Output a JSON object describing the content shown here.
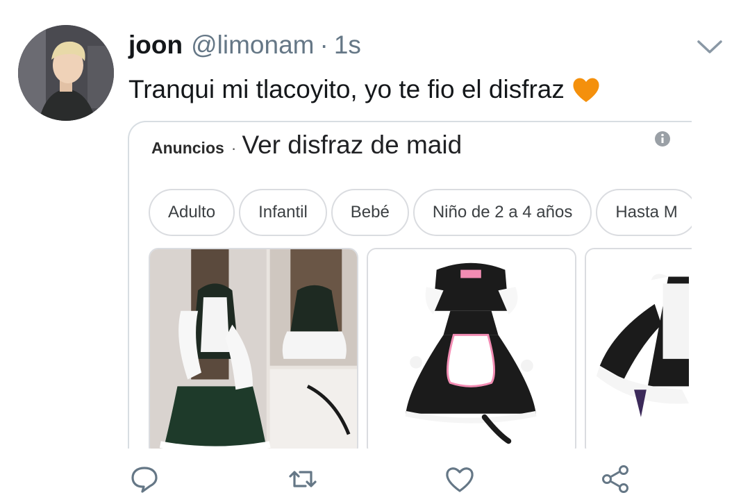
{
  "tweet": {
    "display_name": "joon",
    "handle": "@limonam",
    "separator": "·",
    "time": "1s",
    "text": "Tranqui mi tlacoyito, yo te fio el disfraz",
    "emoji": "orange-heart"
  },
  "ad": {
    "label": "Anuncios",
    "separator": "·",
    "title": "Ver disfraz de maid",
    "chips": [
      "Adulto",
      "Infantil",
      "Bebé",
      "Niño de 2 a 4 años",
      "Hasta M"
    ],
    "products": [
      "maid-dress-photo-collage",
      "cat-maid-dress",
      "maid-dress-sleeve"
    ]
  },
  "actions": [
    "reply-icon",
    "retweet-icon",
    "like-icon",
    "share-icon"
  ],
  "colors": {
    "text": "#14171a",
    "secondary": "#657786",
    "border": "#dadce0",
    "heart": "#f4900c"
  }
}
